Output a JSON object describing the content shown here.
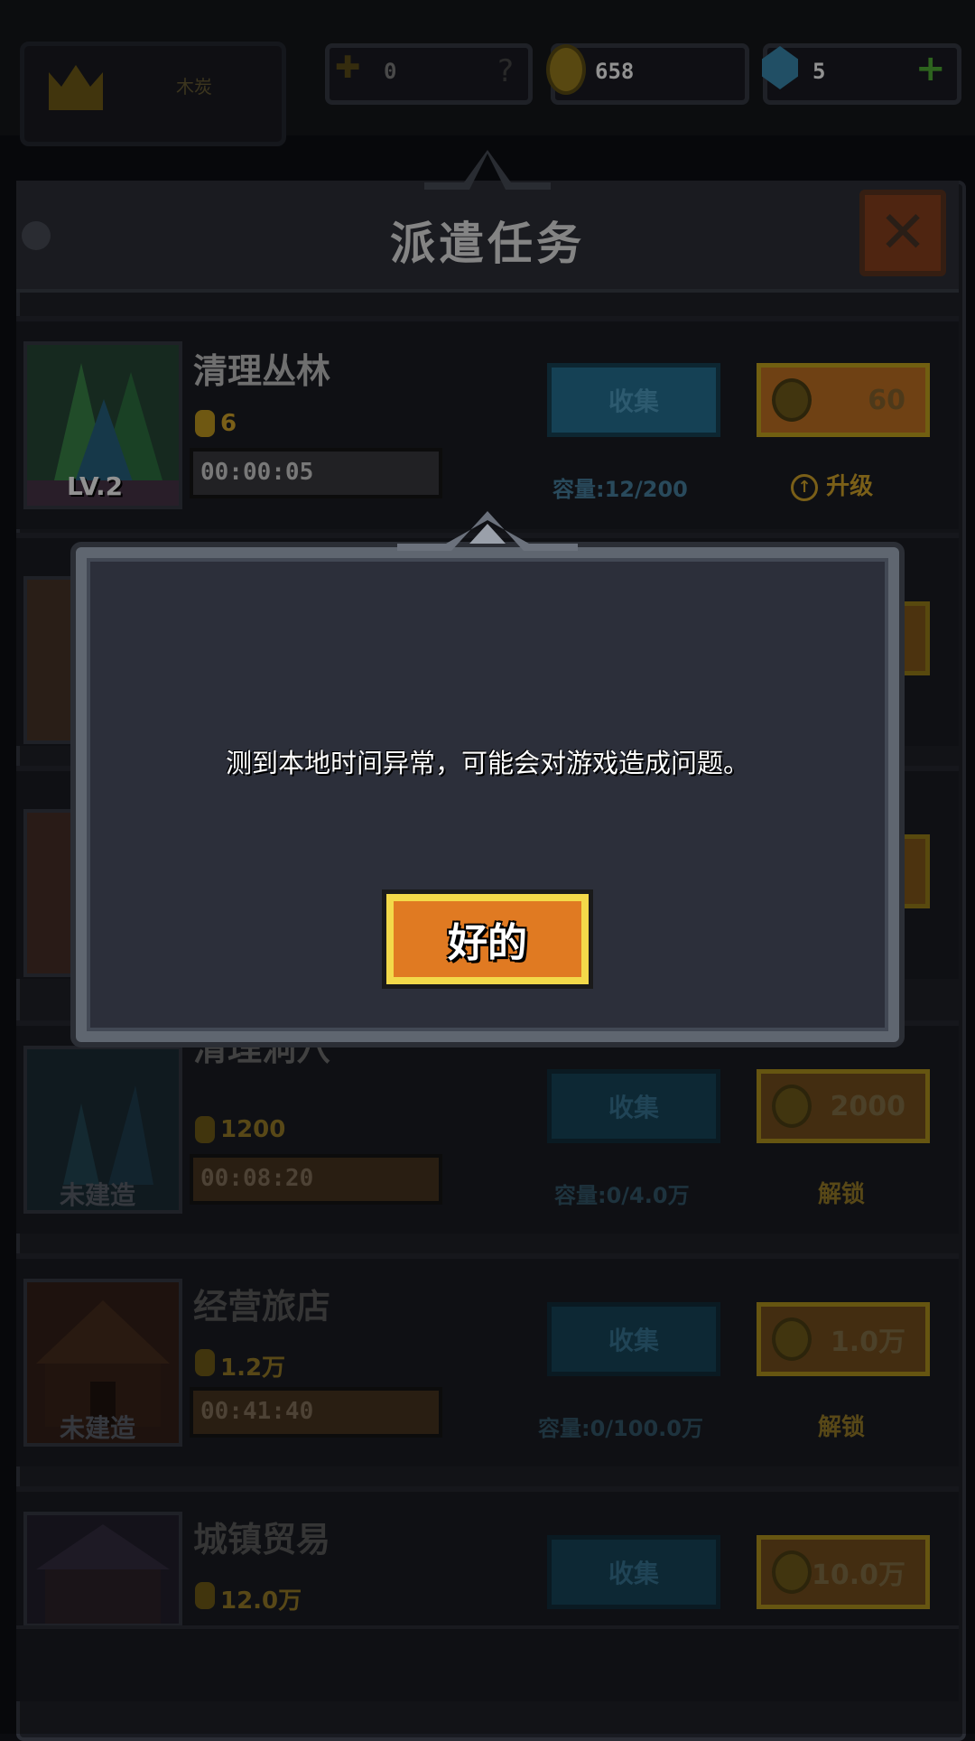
{
  "header": {
    "rank_label": "木炭",
    "trophy_value": "0",
    "help_symbol": "?",
    "coins": "658",
    "gems": "5",
    "add_symbol": "+"
  },
  "panel": {
    "title": "派遣任务",
    "close_symbol": "✕"
  },
  "tasks": [
    {
      "name": "清理丛林",
      "cost": "6",
      "timer": "00:00:05",
      "level": "LV.2",
      "collect": "收集",
      "price": "60",
      "capacity": "容量:12/200",
      "action": "升级"
    },
    {
      "name": "",
      "cost": "",
      "timer": "",
      "level": "",
      "collect": "",
      "price": "",
      "capacity": "",
      "action": ""
    },
    {
      "name": "",
      "cost": "",
      "timer": "",
      "level": "",
      "collect": "",
      "price": "",
      "capacity": "",
      "action": ""
    },
    {
      "name": "清理洞穴",
      "cost": "1200",
      "timer": "00:08:20",
      "level": "未建造",
      "collect": "收集",
      "price": "2000",
      "capacity": "容量:0/4.0万",
      "action": "解锁"
    },
    {
      "name": "经营旅店",
      "cost": "1.2万",
      "timer": "00:41:40",
      "level": "未建造",
      "collect": "收集",
      "price": "1.0万",
      "capacity": "容量:0/100.0万",
      "action": "解锁"
    },
    {
      "name": "城镇贸易",
      "cost": "12.0万",
      "timer": "",
      "level": "",
      "collect": "收集",
      "price": "10.0万",
      "capacity": "",
      "action": ""
    }
  ],
  "dialog": {
    "message": "测到本地时间异常，可能会对游戏造成问题。",
    "ok_label": "好的"
  },
  "colors": {
    "gold": "#f3d94a",
    "orange": "#e07a22",
    "dialog_bg": "#2c2f3a"
  }
}
